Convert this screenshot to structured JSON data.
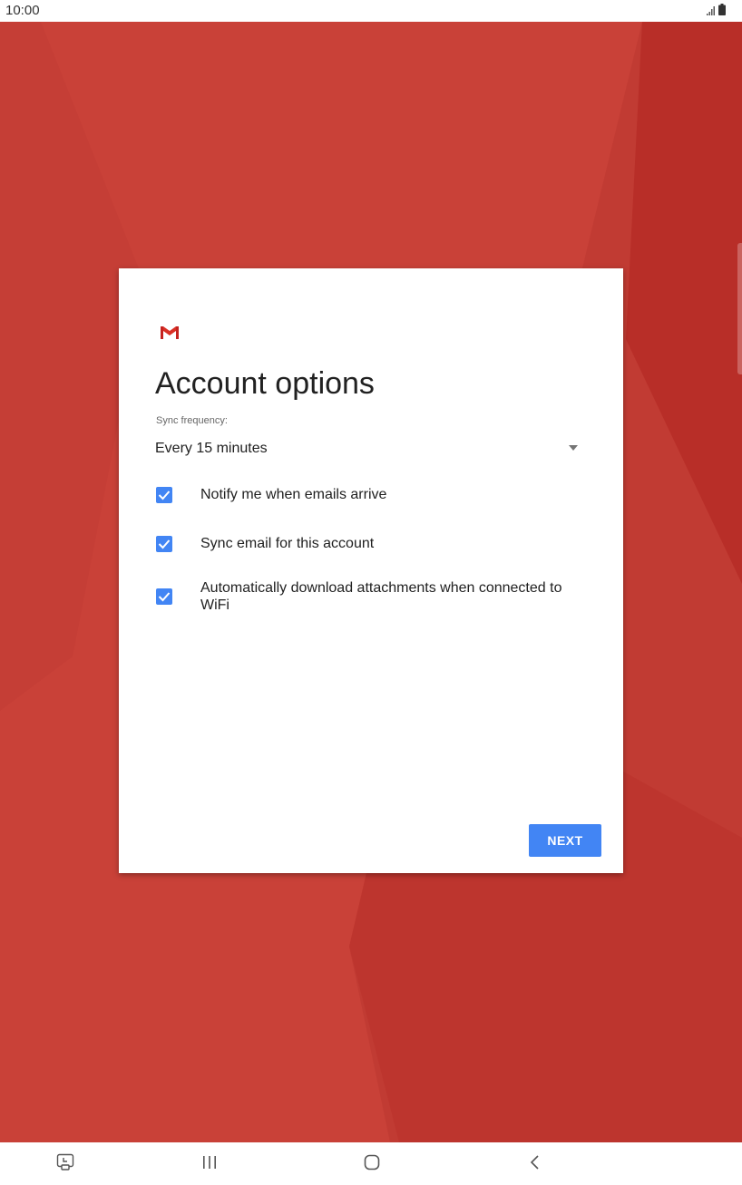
{
  "status_bar": {
    "time": "10:00",
    "icons": [
      "signal-icon",
      "battery-icon"
    ]
  },
  "colors": {
    "wallpaper_base": "#c13b33",
    "wallpaper_light": "#c94138",
    "wallpaper_dark": "#b82e28",
    "accent_blue": "#4285f4",
    "gmail_red": "#d93025"
  },
  "dialog": {
    "logo": "gmail-logo",
    "title": "Account options",
    "sync_label": "Sync frequency:",
    "sync_value": "Every 15 minutes",
    "options": [
      {
        "label": "Notify me when emails arrive",
        "checked": true
      },
      {
        "label": "Sync email for this account",
        "checked": true
      },
      {
        "label": "Automatically download attachments when connected to WiFi",
        "checked": true
      }
    ],
    "next_label": "NEXT"
  },
  "nav_bar": {
    "buttons": [
      "screenshot-icon",
      "recent-apps-icon",
      "home-icon",
      "back-icon"
    ]
  }
}
